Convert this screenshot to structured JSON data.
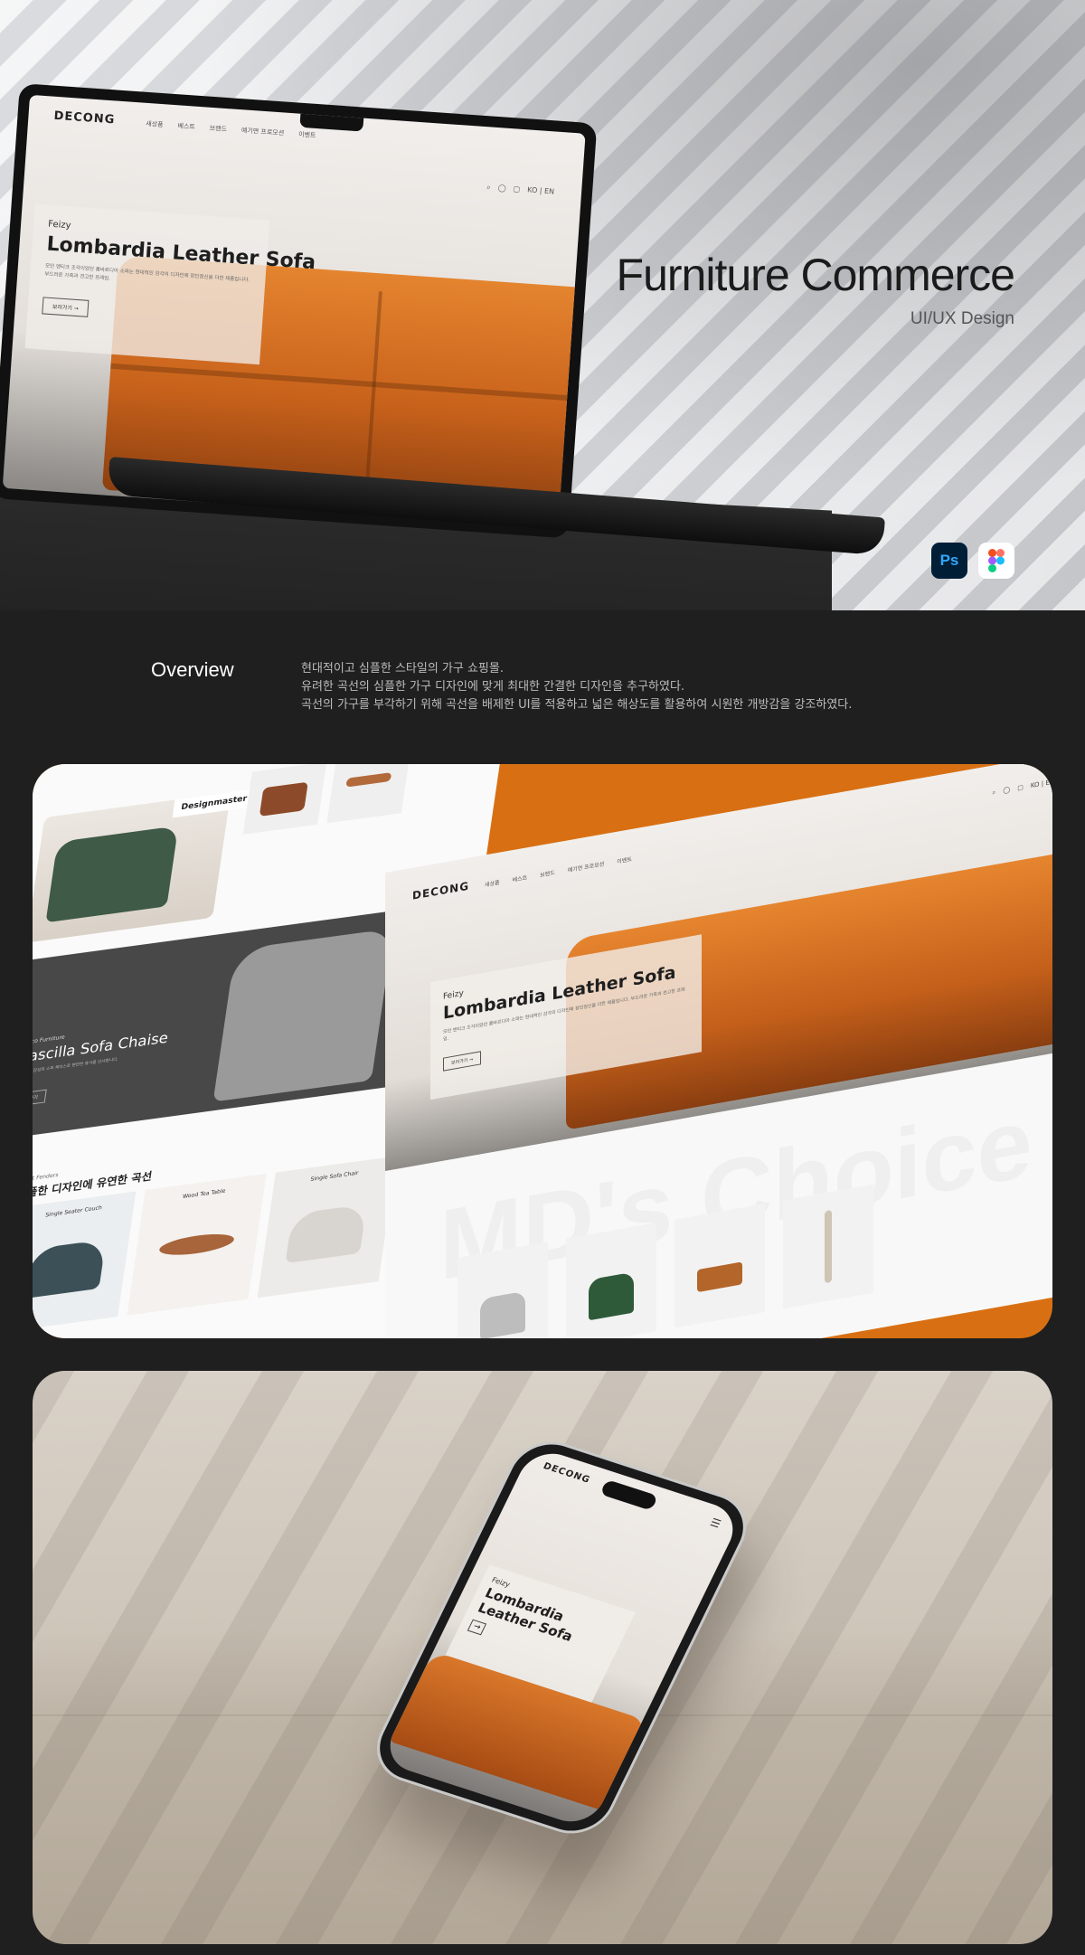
{
  "hero": {
    "title": "Furniture Commerce",
    "subtitle": "UI/UX Design",
    "tools": [
      {
        "label": "Ps",
        "icon": "photoshop-icon",
        "color": "#31a8ff"
      },
      {
        "label": "",
        "icon": "figma-icon"
      }
    ]
  },
  "site": {
    "logo": "DECONG",
    "nav": [
      "새상품",
      "베스트",
      "브랜드",
      "예기면 프로모션",
      "이벤트"
    ],
    "lang": "KO | EN",
    "hero_brand": "Feizy",
    "hero_title": "Lombardia Leather Sofa",
    "hero_desc": "모던 앤티크 조각이었던 롬바르디아 소파는 현대적인 감각의 디자인에 장인정신을 더한 제품입니다. 부드러운 가죽과 견고한 프레임.",
    "hero_button": "보러가기"
  },
  "overview": {
    "heading": "Overview",
    "lines": [
      "현대적이고 심플한 스타일의 가구 쇼핑몰.",
      "유려한 곡선의 심플한 가구 디자인에 맞게 최대한 간결한 디자인을 추구하였다.",
      "곡선의 가구를 부각하기 위해 곡선을 배제한 UI를 적용하고 넓은 해상도를 활용하여 시원한 개방감을 강조하였다."
    ]
  },
  "panel2": {
    "designmaster": "Designmaster",
    "dark_kicker": "Adeco Furniture",
    "dark_title": "Cascilla Sofa Chaise",
    "dark_desc": "현대적인 감성의 소파 체이스로 편안한 휴식을 선사합니다.",
    "dark_button": "보러가기",
    "section_kicker": "Heart Fenders",
    "section_title": "심플한 디자인에 유연한 곡선",
    "cards": [
      "Single Seater Couch",
      "Wood Tea Table",
      "Single Sofa Chair"
    ],
    "watermark": "MD's Choice"
  },
  "panel3": {
    "logo": "DECONG",
    "brand": "Feizy",
    "title": "Lombardia Leather Sofa"
  },
  "colors": {
    "page_bg": "#1f1f1f",
    "accent": "#d87013",
    "leather": "#c8621b"
  }
}
